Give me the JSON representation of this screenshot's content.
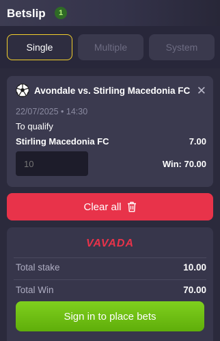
{
  "header": {
    "title": "Betslip",
    "count": "1"
  },
  "tabs": [
    {
      "label": "Single"
    },
    {
      "label": "Multiple"
    },
    {
      "label": "System"
    }
  ],
  "bet": {
    "match": "Avondale vs. Stirling Macedonia FC",
    "datetime": "22/07/2025 • 14:30",
    "market": "To qualify",
    "selection": "Stirling Macedonia FC",
    "odds": "7.00",
    "stake_placeholder": "10",
    "win": "Win: 70.00"
  },
  "actions": {
    "clear_all": "Clear all"
  },
  "brand": {
    "logo_text": "VAVADA"
  },
  "summary": {
    "total_stake_label": "Total stake",
    "total_stake_value": "10.00",
    "total_win_label": "Total Win",
    "total_win_value": "70.00",
    "sign_in_button": "Sign in to place bets"
  },
  "colors": {
    "accent_yellow": "#f3cf2c",
    "clear_red": "#e8334a",
    "sign_in_green": "#6cbd12",
    "background": "#2b2a3c"
  },
  "icons": [
    "soccer-ball-icon",
    "close-icon",
    "trash-icon"
  ]
}
